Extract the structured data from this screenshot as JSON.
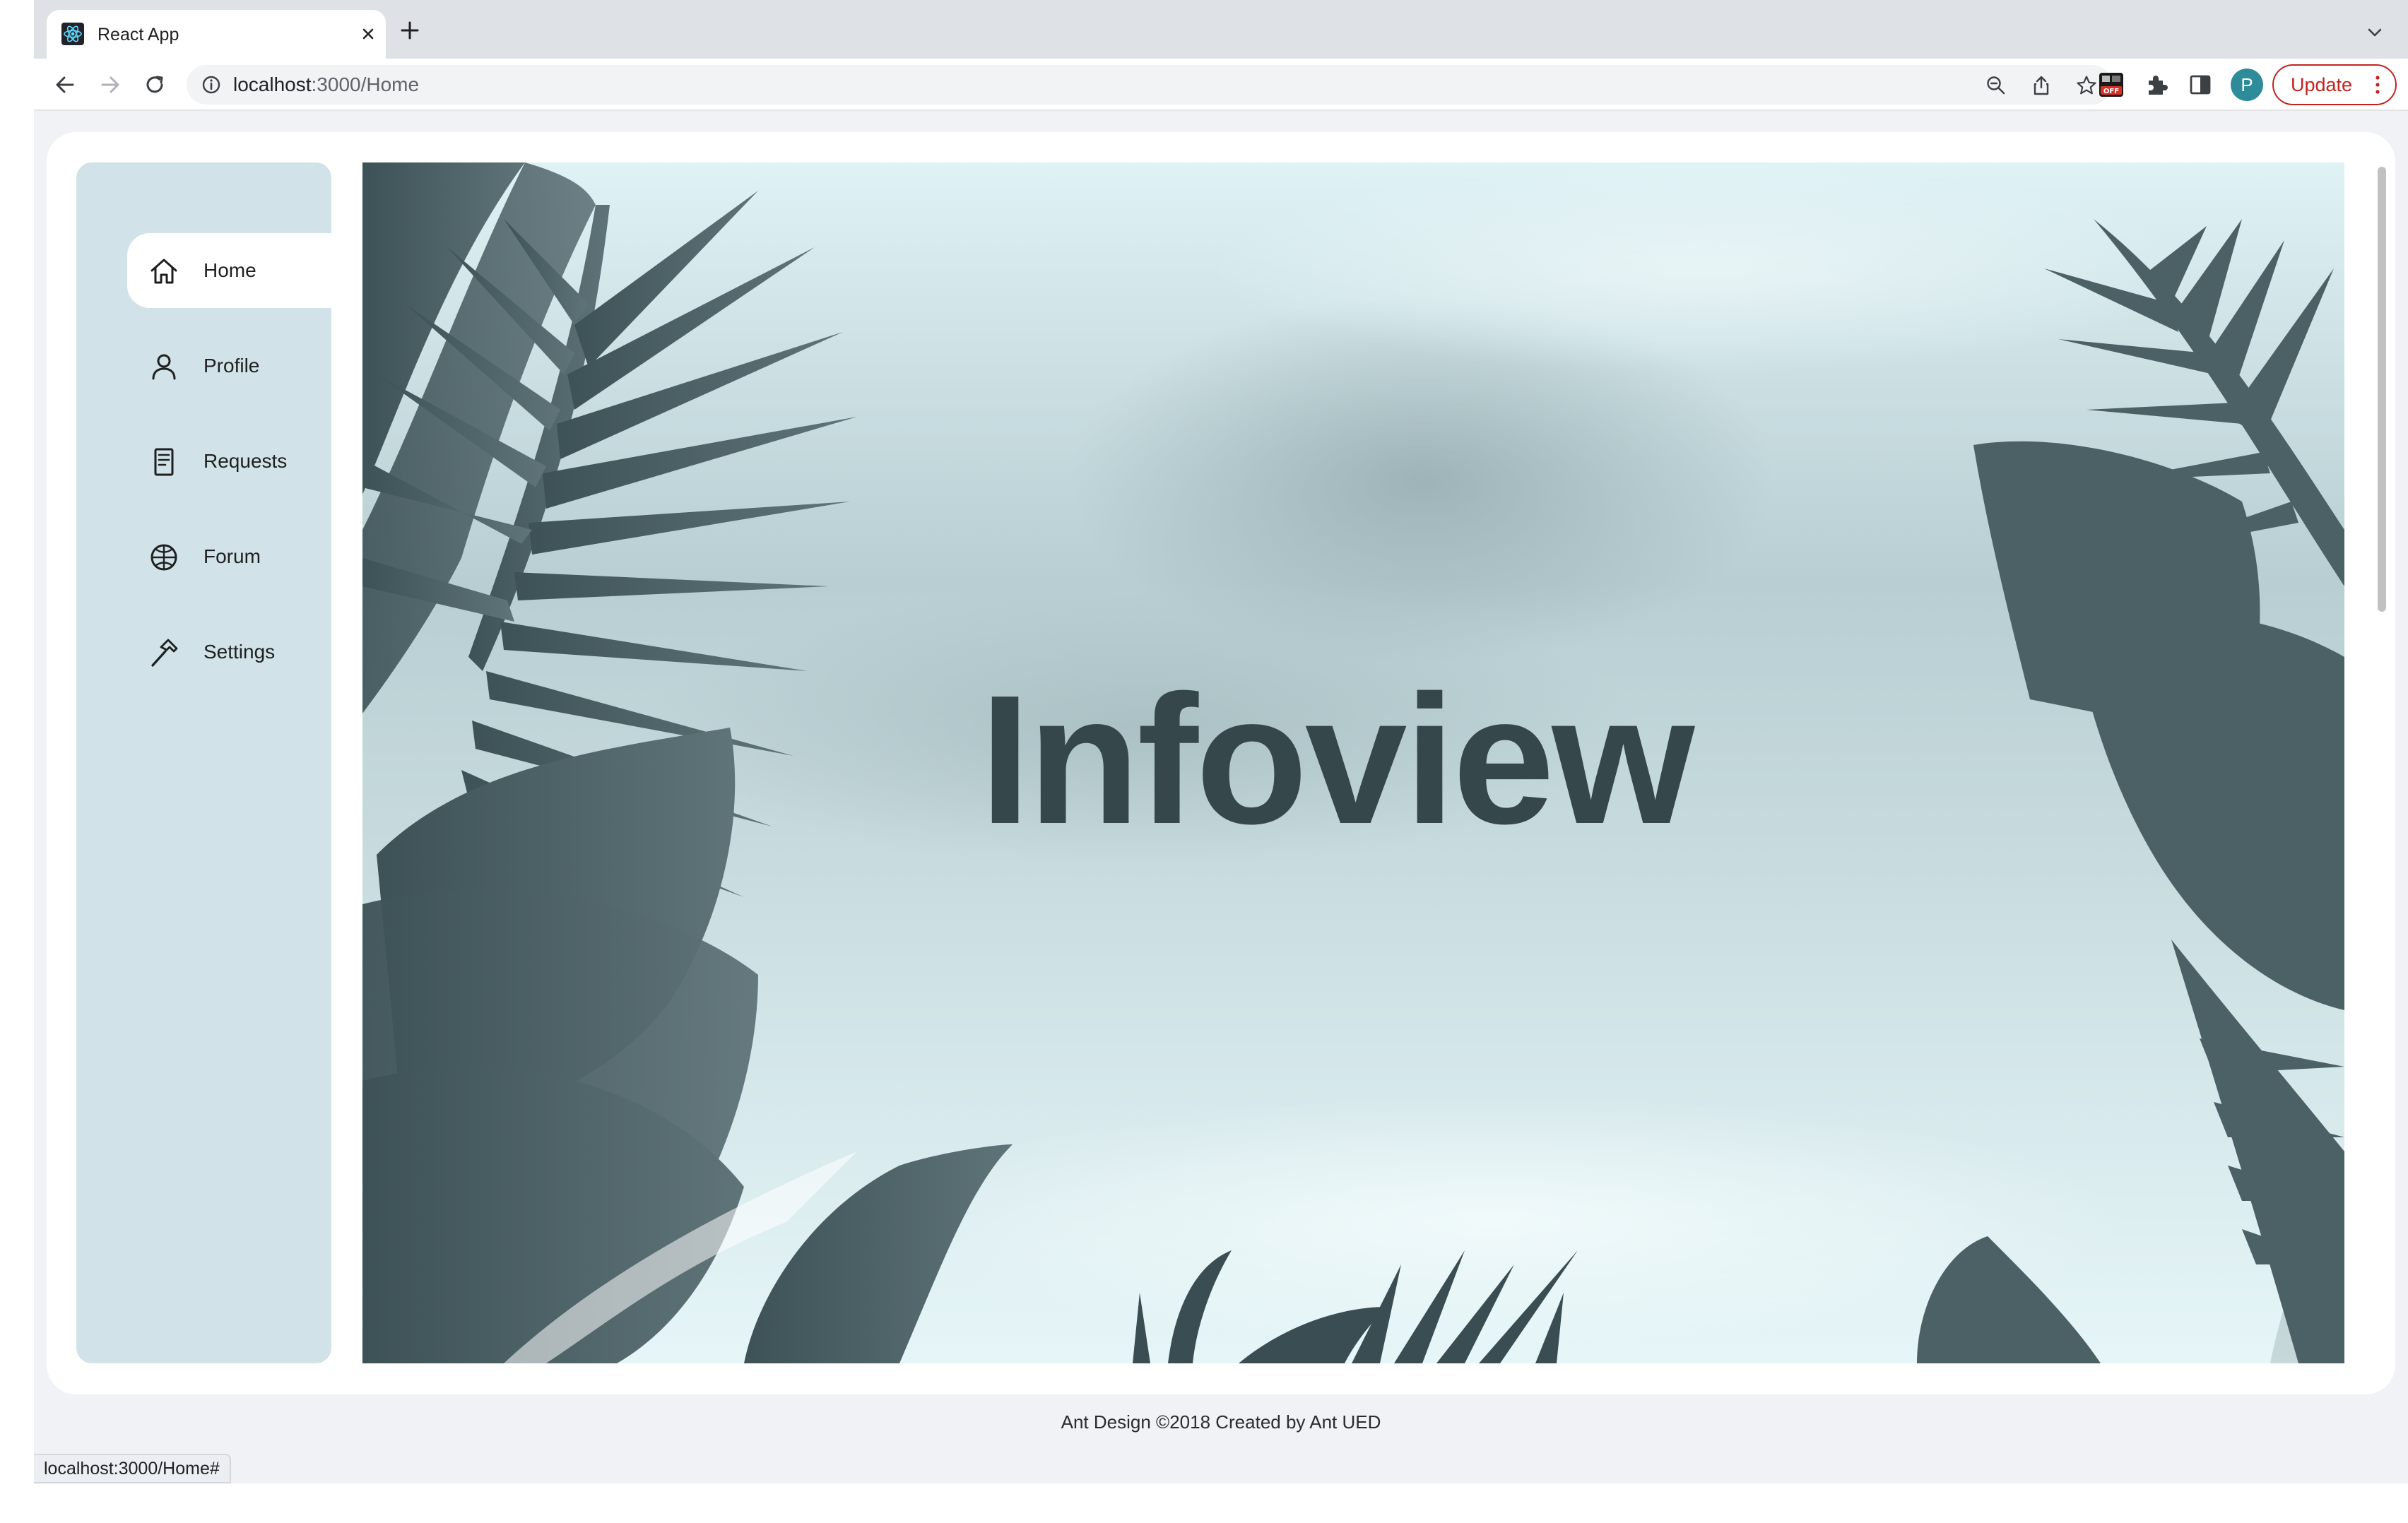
{
  "browser": {
    "tab_title": "React App",
    "url_host": "localhost",
    "url_rest": ":3000/Home",
    "update_label": "Update",
    "profile_initial": "P",
    "status_url": "localhost:3000/Home#",
    "accent": "#c5221f"
  },
  "sidebar": {
    "items": [
      {
        "label": "Home",
        "icon": "home-icon",
        "active": true
      },
      {
        "label": "Profile",
        "icon": "user-icon",
        "active": false
      },
      {
        "label": "Requests",
        "icon": "file-text-icon",
        "active": false
      },
      {
        "label": "Forum",
        "icon": "globe-icon",
        "active": false
      },
      {
        "label": "Settings",
        "icon": "hammer-icon",
        "active": false
      }
    ]
  },
  "hero": {
    "title": "Infoview"
  },
  "footer": {
    "text": "Ant Design ©2018 Created by Ant UED"
  },
  "colors": {
    "sidebar_bg": "#d1e3e8",
    "hero_title": "#36474c",
    "page_bg": "#f0f2f5"
  }
}
